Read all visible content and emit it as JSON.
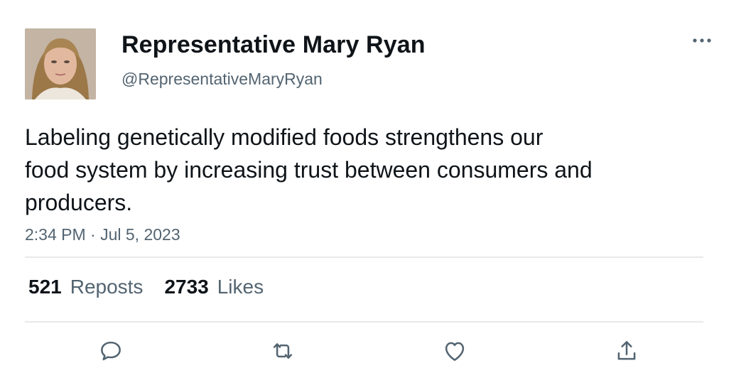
{
  "author": {
    "display_name": "Representative Mary Ryan",
    "handle": "@RepresentativeMaryRyan",
    "avatar_icon": "profile-photo"
  },
  "tweet": {
    "text_lines": [
      "Labeling genetically modified foods strengthens our",
      "food system by increasing trust between consumers and",
      "producers."
    ],
    "timestamp": "2:34 PM · Jul 5, 2023"
  },
  "stats": {
    "reposts_count": "521",
    "reposts_label": "Reposts",
    "likes_count": "2733",
    "likes_label": "Likes"
  },
  "actions": {
    "more_icon": "more-horizontal-icon",
    "reply_icon": "reply-icon",
    "repost_icon": "repost-icon",
    "like_icon": "heart-icon",
    "share_icon": "share-icon"
  },
  "colors": {
    "text_primary": "#0f1419",
    "text_secondary": "#536471",
    "divider": "#e7e9ea",
    "icon": "#536471"
  }
}
